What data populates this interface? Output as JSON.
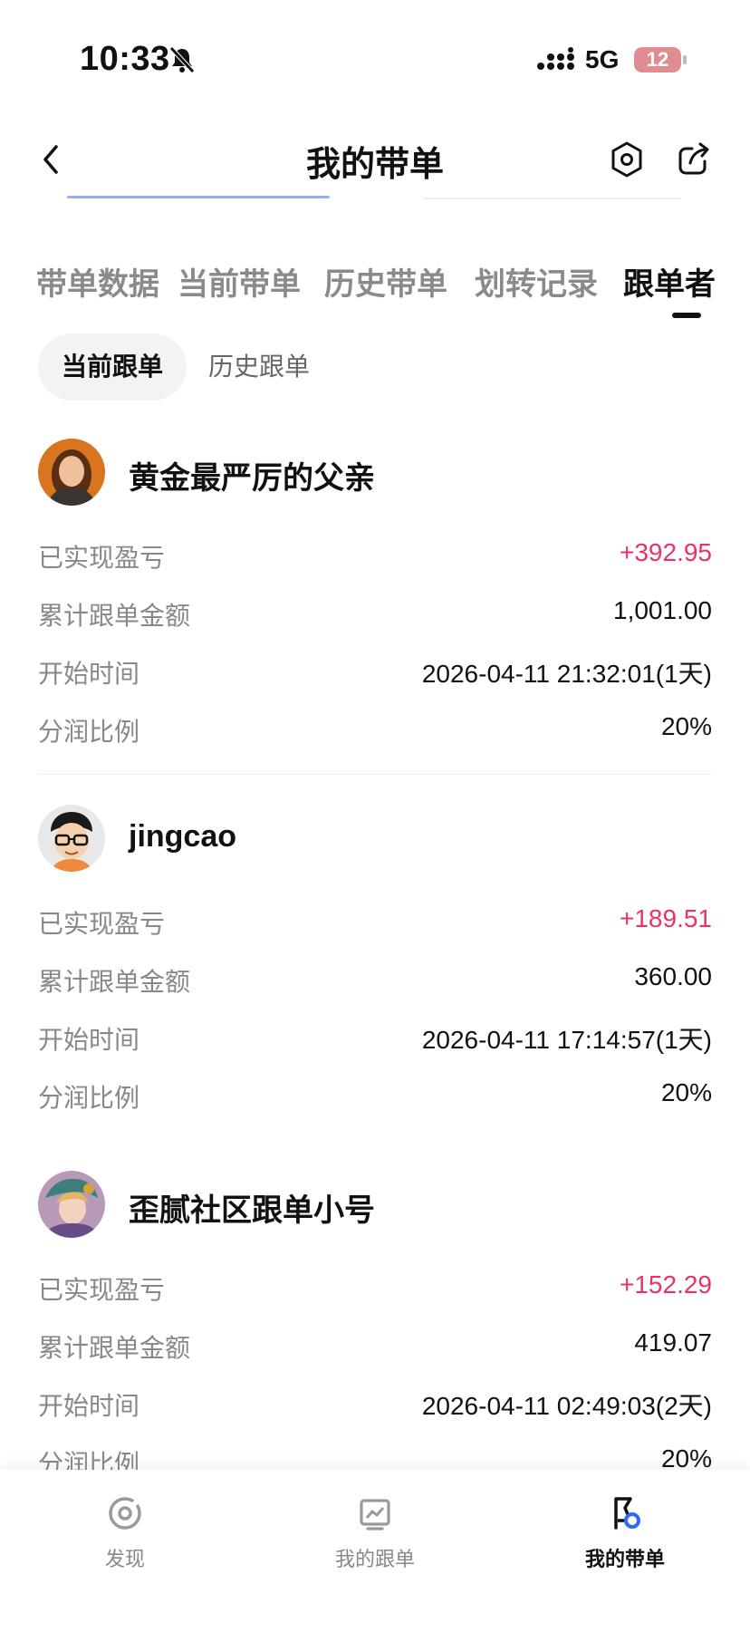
{
  "status_bar": {
    "time": "10:33",
    "network": "5G",
    "battery": "12"
  },
  "header": {
    "title": "我的带单"
  },
  "tabs": [
    {
      "label": "带单数据",
      "active": false
    },
    {
      "label": "当前带单",
      "active": false
    },
    {
      "label": "历史带单",
      "active": false
    },
    {
      "label": "划转记录",
      "active": false
    },
    {
      "label": "跟单者",
      "active": true
    }
  ],
  "subtabs": [
    {
      "label": "当前跟单",
      "active": true
    },
    {
      "label": "历史跟单",
      "active": false
    }
  ],
  "field_labels": {
    "realized_pnl": "已实现盈亏",
    "total_amount": "累计跟单金额",
    "start_time": "开始时间",
    "profit_share": "分润比例"
  },
  "followers": [
    {
      "name": "黄金最严厉的父亲",
      "realized_pnl": "+392.95",
      "total_amount": "1,001.00",
      "start_time": "2026-04-11 21:32:01(1天)",
      "profit_share": "20%"
    },
    {
      "name": "jingcao",
      "realized_pnl": "+189.51",
      "total_amount": "360.00",
      "start_time": "2026-04-11 17:14:57(1天)",
      "profit_share": "20%"
    },
    {
      "name": "歪腻社区跟单小号",
      "realized_pnl": "+152.29",
      "total_amount": "419.07",
      "start_time": "2026-04-11 02:49:03(2天)",
      "profit_share": "20%"
    }
  ],
  "bottom_nav": [
    {
      "label": "发现",
      "icon": "discover-icon",
      "active": false
    },
    {
      "label": "我的跟单",
      "icon": "chart-icon",
      "active": false
    },
    {
      "label": "我的带单",
      "icon": "lead-trade-icon",
      "active": true
    }
  ],
  "colors": {
    "profit": "#e8336a",
    "active_text": "#111111",
    "inactive_text": "#8a8a8a"
  }
}
